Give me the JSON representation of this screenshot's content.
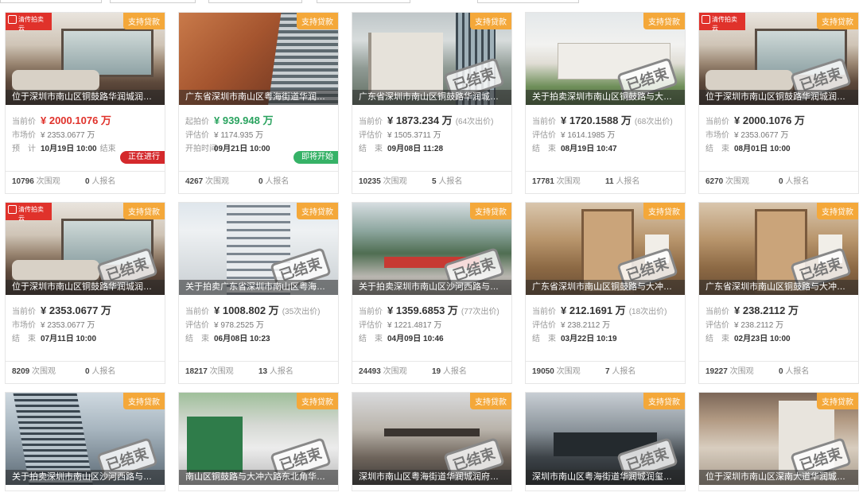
{
  "badge_text": "支持贷款",
  "logo_text": "清传拍卖云",
  "stamp_text": "已结束",
  "cards": [
    {
      "bg": "bg-room",
      "logo": true,
      "stamp": false,
      "title": "位于深圳市南山区铜鼓路华润城润府二…",
      "l1": "当前价",
      "price": "¥ 2000.1076 万",
      "price_color": "red",
      "bids": "",
      "l2": "市场价",
      "v2": "¥ 2353.0677 万",
      "l3": "预　计",
      "time": "10月19日 10:00",
      "after": "结束",
      "status": "正在进行",
      "status_type": "live",
      "views": "10796",
      "views_label": "次围观",
      "signups": "0",
      "signups_label": "人报名"
    },
    {
      "bg": "bg-tower-orange",
      "logo": false,
      "stamp": false,
      "title": "广东省深圳市南山区粤海街道华润城润…",
      "l1": "起拍价",
      "price": "¥ 939.948 万",
      "price_color": "green",
      "bids": "",
      "l2": "评估价",
      "v2": "¥ 1174.935 万",
      "l3": "开拍时间",
      "time": "09月21日 10:00",
      "after": "",
      "status": "即将开始",
      "status_type": "soon",
      "views": "4267",
      "views_label": "次围观",
      "signups": "0",
      "signups_label": "人报名"
    },
    {
      "bg": "bg-modern",
      "logo": false,
      "stamp": true,
      "title": "广东省深圳市南山区铜鼓路华润城润府…",
      "l1": "当前价",
      "price": "¥ 1873.234 万",
      "price_color": "dark",
      "bids": "(64次出价)",
      "l2": "评估价",
      "v2": "¥ 1505.3711 万",
      "l3": "结　束",
      "time": "09月08日 11:28",
      "after": "",
      "status": "",
      "status_type": "",
      "views": "10235",
      "views_label": "次围观",
      "signups": "5",
      "signups_label": "人报名"
    },
    {
      "bg": "bg-park",
      "logo": false,
      "stamp": true,
      "title": "关于拍卖深圳市南山区铜鼓路与大冲六…",
      "l1": "当前价",
      "price": "¥ 1720.1588 万",
      "price_color": "dark",
      "bids": "(68次出价)",
      "l2": "评估价",
      "v2": "¥ 1614.1985 万",
      "l3": "结　束",
      "time": "08月19日 10:47",
      "after": "",
      "status": "",
      "status_type": "",
      "views": "17781",
      "views_label": "次围观",
      "signups": "11",
      "signups_label": "人报名"
    },
    {
      "bg": "bg-room",
      "logo": true,
      "stamp": true,
      "title": "位于深圳市南山区铜鼓路华润城润府二…",
      "l1": "当前价",
      "price": "¥ 2000.1076 万",
      "price_color": "dark",
      "bids": "",
      "l2": "市场价",
      "v2": "¥ 2353.0677 万",
      "l3": "结　束",
      "time": "08月01日 10:00",
      "after": "",
      "status": "",
      "status_type": "",
      "views": "6270",
      "views_label": "次围观",
      "signups": "0",
      "signups_label": "人报名"
    },
    {
      "bg": "bg-room",
      "logo": true,
      "stamp": true,
      "title": "位于深圳市南山区铜鼓路华润城润府二…",
      "l1": "当前价",
      "price": "¥ 2353.0677 万",
      "price_color": "dark",
      "bids": "",
      "l2": "市场价",
      "v2": "¥ 2353.0677 万",
      "l3": "结　束",
      "time": "07月11日 10:00",
      "after": "",
      "status": "",
      "status_type": "",
      "views": "8209",
      "views_label": "次围观",
      "signups": "0",
      "signups_label": "人报名"
    },
    {
      "bg": "bg-tall",
      "logo": false,
      "stamp": true,
      "title": "关于拍卖广东省深圳市南山区粤海街道…",
      "l1": "当前价",
      "price": "¥ 1008.802 万",
      "price_color": "dark",
      "bids": "(35次出价)",
      "l2": "评估价",
      "v2": "¥ 978.2525 万",
      "l3": "结　束",
      "time": "06月08日 10:23",
      "after": "",
      "status": "",
      "status_type": "",
      "views": "18217",
      "views_label": "次围观",
      "signups": "13",
      "signups_label": "人报名"
    },
    {
      "bg": "bg-plaza",
      "logo": false,
      "stamp": true,
      "title": "关于拍卖深圳市南山区沙河西路与大冲…",
      "l1": "当前价",
      "price": "¥ 1359.6853 万",
      "price_color": "dark",
      "bids": "(77次出价)",
      "l2": "评估价",
      "v2": "¥ 1221.4817 万",
      "l3": "结　束",
      "time": "04月09日 10:46",
      "after": "",
      "status": "",
      "status_type": "",
      "views": "24493",
      "views_label": "次围观",
      "signups": "19",
      "signups_label": "人报名"
    },
    {
      "bg": "bg-hall",
      "logo": false,
      "stamp": true,
      "title": "广东省深圳市南山区铜鼓路与大冲六路…",
      "l1": "当前价",
      "price": "¥ 212.1691 万",
      "price_color": "dark",
      "bids": "(18次出价)",
      "l2": "评估价",
      "v2": "¥ 238.2112 万",
      "l3": "结　束",
      "time": "03月22日 10:19",
      "after": "",
      "status": "",
      "status_type": "",
      "views": "19050",
      "views_label": "次围观",
      "signups": "7",
      "signups_label": "人报名"
    },
    {
      "bg": "bg-hall",
      "logo": false,
      "stamp": true,
      "title": "广东省深圳市南山区铜鼓路与大冲六路…",
      "l1": "当前价",
      "price": "¥ 238.2112 万",
      "price_color": "dark",
      "bids": "",
      "l2": "评估价",
      "v2": "¥ 238.2112 万",
      "l3": "结　束",
      "time": "02月23日 10:00",
      "after": "",
      "status": "",
      "status_type": "",
      "views": "19227",
      "views_label": "次围观",
      "signups": "0",
      "signups_label": "人报名"
    },
    {
      "bg": "bg-tower-blue",
      "logo": false,
      "stamp": true,
      "title": "关于拍卖深圳市南山区沙河西路与大冲…"
    },
    {
      "bg": "bg-shop",
      "logo": false,
      "stamp": true,
      "title": "南山区铜鼓路与大冲六路东北角华润城…"
    },
    {
      "bg": "bg-entrance",
      "logo": false,
      "stamp": true,
      "title": "深圳市南山区粤海街道华润城润府（二…"
    },
    {
      "bg": "bg-dark-lobby",
      "logo": false,
      "stamp": true,
      "title": "深圳市南山区粤海街道华润城润玺二期…"
    },
    {
      "bg": "bg-interior",
      "logo": false,
      "stamp": true,
      "title": "位于深圳市南山区深南大道华润城华润…"
    }
  ]
}
